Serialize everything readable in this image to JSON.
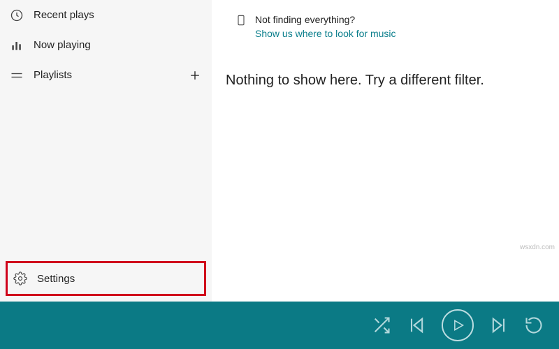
{
  "sidebar": {
    "items": [
      {
        "label": "Recent plays",
        "icon": "clock-icon"
      },
      {
        "label": "Now playing",
        "icon": "bars-icon"
      },
      {
        "label": "Playlists",
        "icon": "playlist-icon"
      }
    ],
    "settings_label": "Settings"
  },
  "content": {
    "info_title": "Not finding everything?",
    "info_link": "Show us where to look for music",
    "empty_text": "Nothing to show here. Try a different filter."
  },
  "player": {
    "accent": "#0b7a85"
  },
  "watermark": "wsxdn.com"
}
